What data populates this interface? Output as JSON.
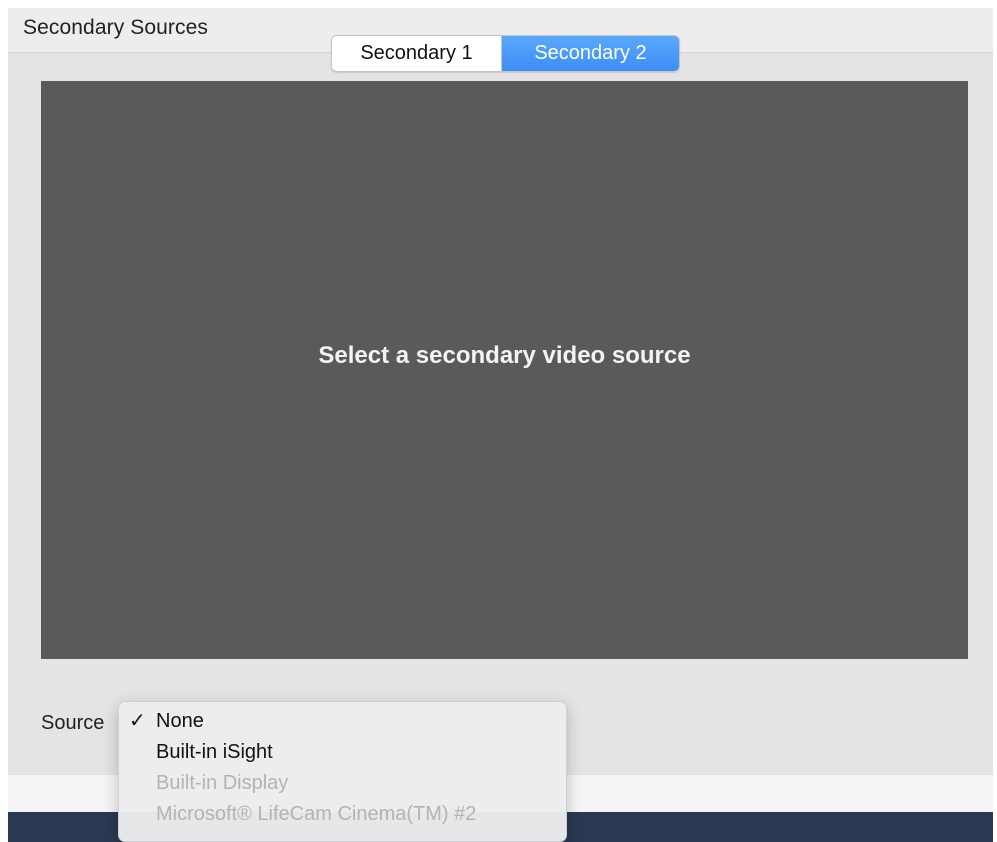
{
  "header": {
    "title": "Secondary Sources"
  },
  "tabs": [
    {
      "label": "Secondary 1",
      "selected": false
    },
    {
      "label": "Secondary 2",
      "selected": true
    }
  ],
  "preview": {
    "message": "Select a secondary video source"
  },
  "source": {
    "label": "Source",
    "menu": [
      {
        "label": "None",
        "checked": true,
        "enabled": true,
        "check_glyph": "✓"
      },
      {
        "label": "Built-in iSight",
        "checked": false,
        "enabled": true
      },
      {
        "label": "Built-in Display",
        "checked": false,
        "enabled": false
      },
      {
        "label": "Microsoft® LifeCam Cinema(TM) #2",
        "checked": false,
        "enabled": false
      }
    ]
  },
  "colors": {
    "accent": "#3d8df6",
    "preview_bg": "#5a5a5a",
    "bottom_bar": "#293951"
  }
}
